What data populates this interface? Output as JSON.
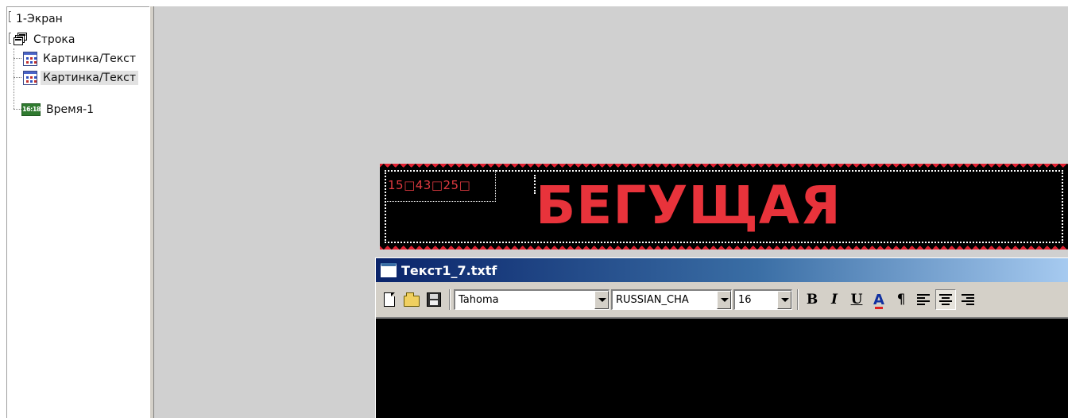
{
  "tree": {
    "items": [
      {
        "label": "1-Экран",
        "icon": "screen-icon"
      },
      {
        "label": "Строка",
        "icon": "rows-stack-icon"
      },
      {
        "label": "Картинка/Текст",
        "icon": "picture-text-icon"
      },
      {
        "label": "Картинка/Текст",
        "icon": "picture-text-icon",
        "selected": true
      },
      {
        "label": "Время-1",
        "icon": "clock-display-icon",
        "icon_text": "16:18"
      }
    ]
  },
  "led_preview": {
    "clock_text": "15□43□25□",
    "scroll_text": "БЕГУЩАЯ",
    "text_color": "#e8333b",
    "background": "#000000"
  },
  "editor": {
    "title": "Текст1_7.txtf",
    "toolbar": {
      "font": "Tahoma",
      "charset": "RUSSIAN_CHA",
      "size": "16",
      "bold_label": "B",
      "italic_label": "I",
      "underline_label": "U",
      "color_label": "A",
      "paragraph_label": "¶"
    },
    "text_area_background": "#000000"
  },
  "colors": {
    "workspace": "#d0d0d0",
    "title_gradient_start": "#0a246a",
    "title_gradient_end": "#a6caf0",
    "led_red": "#e02030"
  }
}
